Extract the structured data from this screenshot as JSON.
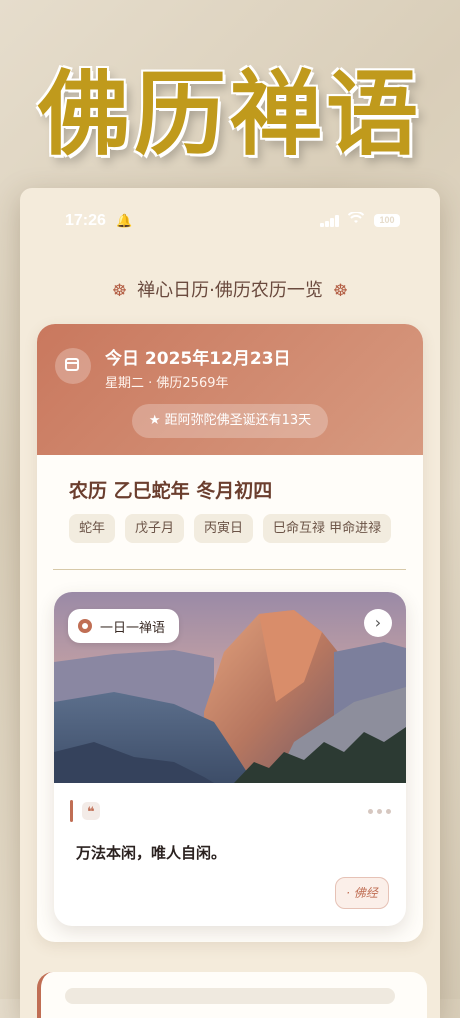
{
  "headline": "佛历禅语",
  "status_bar": {
    "time": "17:26",
    "battery": "100"
  },
  "app_title": {
    "text": "禅心日历·佛历农历一览",
    "ornament": "☸"
  },
  "today": {
    "date": "今日 2025年12月23日",
    "weekday_era": "星期二 · 佛历2569年",
    "countdown": "★ 距阿弥陀佛圣诞还有13天"
  },
  "lunar": {
    "title": "农历 乙巳蛇年 冬月初四",
    "tags": [
      "蛇年",
      "戊子月",
      "丙寅日",
      "巳命互禄 甲命进禄"
    ]
  },
  "zen": {
    "badge": "一日一禅语",
    "quote_mark": "❝",
    "quote": "万法本闲，唯人自闲。",
    "source": "· 佛经"
  },
  "icons": [
    "bell-icon",
    "signal-icon",
    "wifi-icon",
    "battery-icon",
    "dharma-wheel-icon",
    "calendar-icon",
    "lotus-icon",
    "chevron-right-icon",
    "quote-icon",
    "more-dots-icon"
  ],
  "colors": {
    "accent": "#c06e54",
    "headline_gold": "#c09a1c",
    "page_bg": "#f4ebdb"
  }
}
